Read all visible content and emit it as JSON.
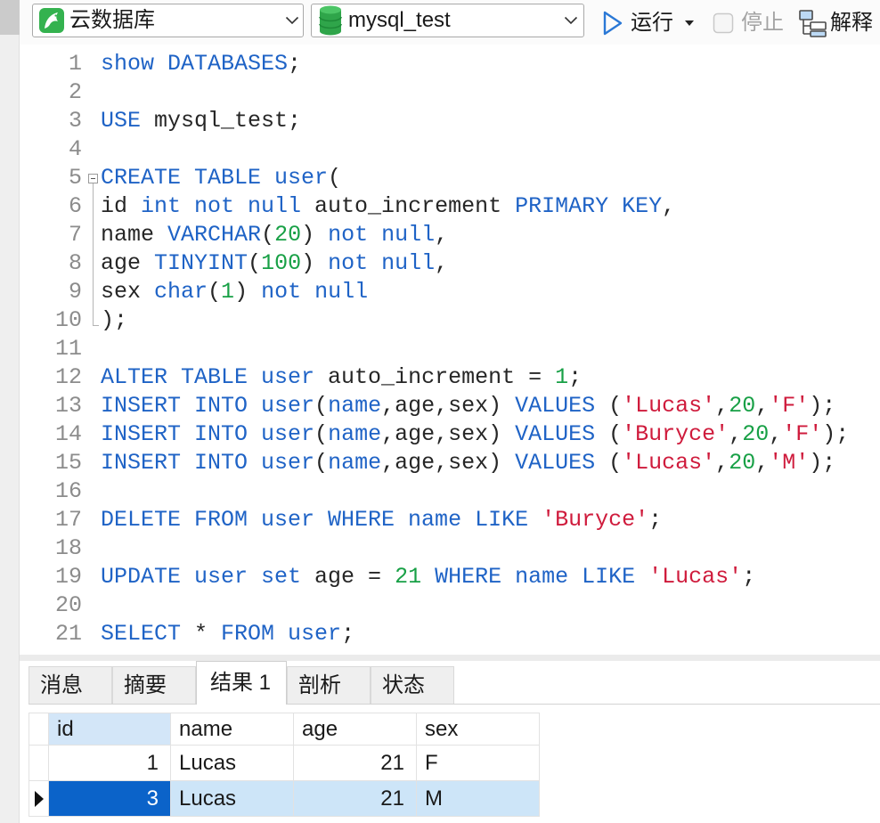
{
  "toolbar": {
    "connection": {
      "label": "云数据库",
      "icon": "navicat-cloud-icon"
    },
    "database": {
      "label": "mysql_test",
      "icon": "database-icon"
    },
    "run": {
      "label": "运行",
      "icon": "play-icon"
    },
    "stop": {
      "label": "停止",
      "icon": "stop-icon",
      "enabled": false
    },
    "explain": {
      "label": "解释",
      "icon": "explain-plan-icon"
    }
  },
  "editor": {
    "lines": [
      {
        "no": 1,
        "tokens": [
          {
            "kw": "show DATABASES"
          },
          {
            "t": ";"
          }
        ]
      },
      {
        "no": 2,
        "tokens": []
      },
      {
        "no": 3,
        "tokens": [
          {
            "kw": "USE"
          },
          {
            "t": " mysql_test;"
          }
        ]
      },
      {
        "no": 4,
        "tokens": []
      },
      {
        "no": 5,
        "tokens": [
          {
            "kw": "CREATE TABLE user"
          },
          {
            "t": "("
          }
        ]
      },
      {
        "no": 6,
        "tokens": [
          {
            "t": "id "
          },
          {
            "kw": "int not null"
          },
          {
            "t": " auto_increment "
          },
          {
            "kw": "PRIMARY KEY"
          },
          {
            "t": ","
          }
        ]
      },
      {
        "no": 7,
        "tokens": [
          {
            "t": "name "
          },
          {
            "kw": "VARCHAR"
          },
          {
            "t": "("
          },
          {
            "num": "20"
          },
          {
            "t": ") "
          },
          {
            "kw": "not null"
          },
          {
            "t": ","
          }
        ]
      },
      {
        "no": 8,
        "tokens": [
          {
            "t": "age "
          },
          {
            "kw": "TINYINT"
          },
          {
            "t": "("
          },
          {
            "num": "100"
          },
          {
            "t": ") "
          },
          {
            "kw": "not null"
          },
          {
            "t": ","
          }
        ]
      },
      {
        "no": 9,
        "tokens": [
          {
            "t": "sex "
          },
          {
            "kw": "char"
          },
          {
            "t": "("
          },
          {
            "num": "1"
          },
          {
            "t": ") "
          },
          {
            "kw": "not null"
          }
        ]
      },
      {
        "no": 10,
        "tokens": [
          {
            "t": ");"
          }
        ]
      },
      {
        "no": 11,
        "tokens": []
      },
      {
        "no": 12,
        "tokens": [
          {
            "kw": "ALTER TABLE user"
          },
          {
            "t": " auto_increment = "
          },
          {
            "num": "1"
          },
          {
            "t": ";"
          }
        ]
      },
      {
        "no": 13,
        "tokens": [
          {
            "kw": "INSERT INTO user"
          },
          {
            "t": "("
          },
          {
            "kw": "name"
          },
          {
            "t": ",age,sex) "
          },
          {
            "kw": "VALUES"
          },
          {
            "t": " ("
          },
          {
            "str": "'Lucas'"
          },
          {
            "t": ","
          },
          {
            "num": "20"
          },
          {
            "t": ","
          },
          {
            "str": "'F'"
          },
          {
            "t": ");"
          }
        ]
      },
      {
        "no": 14,
        "tokens": [
          {
            "kw": "INSERT INTO user"
          },
          {
            "t": "("
          },
          {
            "kw": "name"
          },
          {
            "t": ",age,sex) "
          },
          {
            "kw": "VALUES"
          },
          {
            "t": " ("
          },
          {
            "str": "'Buryce'"
          },
          {
            "t": ","
          },
          {
            "num": "20"
          },
          {
            "t": ","
          },
          {
            "str": "'F'"
          },
          {
            "t": ");"
          }
        ]
      },
      {
        "no": 15,
        "tokens": [
          {
            "kw": "INSERT INTO user"
          },
          {
            "t": "("
          },
          {
            "kw": "name"
          },
          {
            "t": ",age,sex) "
          },
          {
            "kw": "VALUES"
          },
          {
            "t": " ("
          },
          {
            "str": "'Lucas'"
          },
          {
            "t": ","
          },
          {
            "num": "20"
          },
          {
            "t": ","
          },
          {
            "str": "'M'"
          },
          {
            "t": ");"
          }
        ]
      },
      {
        "no": 16,
        "tokens": []
      },
      {
        "no": 17,
        "tokens": [
          {
            "kw": "DELETE FROM user WHERE name LIKE"
          },
          {
            "t": " "
          },
          {
            "str": "'Buryce'"
          },
          {
            "t": ";"
          }
        ]
      },
      {
        "no": 18,
        "tokens": []
      },
      {
        "no": 19,
        "tokens": [
          {
            "kw": "UPDATE user set"
          },
          {
            "t": " age = "
          },
          {
            "num": "21"
          },
          {
            "t": " "
          },
          {
            "kw": "WHERE name LIKE"
          },
          {
            "t": " "
          },
          {
            "str": "'Lucas'"
          },
          {
            "t": ";"
          }
        ]
      },
      {
        "no": 20,
        "tokens": []
      },
      {
        "no": 21,
        "tokens": [
          {
            "kw": "SELECT"
          },
          {
            "t": " * "
          },
          {
            "kw": "FROM user"
          },
          {
            "t": ";"
          }
        ]
      }
    ]
  },
  "results": {
    "tabs": [
      {
        "label": "消息"
      },
      {
        "label": "摘要"
      },
      {
        "label": "结果 1"
      },
      {
        "label": "剖析"
      },
      {
        "label": "状态"
      }
    ],
    "active_tab": 2,
    "grid": {
      "columns": [
        "id",
        "name",
        "age",
        "sex"
      ],
      "rows": [
        [
          1,
          "Lucas",
          21,
          "F"
        ],
        [
          3,
          "Lucas",
          21,
          "M"
        ]
      ],
      "selected_row": 1,
      "active_column": 0,
      "pointer_icon": "current-row-pointer-icon"
    }
  },
  "colors": {
    "keyword": "#1f63c6",
    "number": "#18a046",
    "string": "#cf1b3c",
    "text": "#262626",
    "line_number": "#8c8c8c",
    "active_header": "#d3e6f8",
    "selected_row": "#cde5f8",
    "selected_cell": "#0b63c9",
    "brand_green": "#34b24f"
  }
}
